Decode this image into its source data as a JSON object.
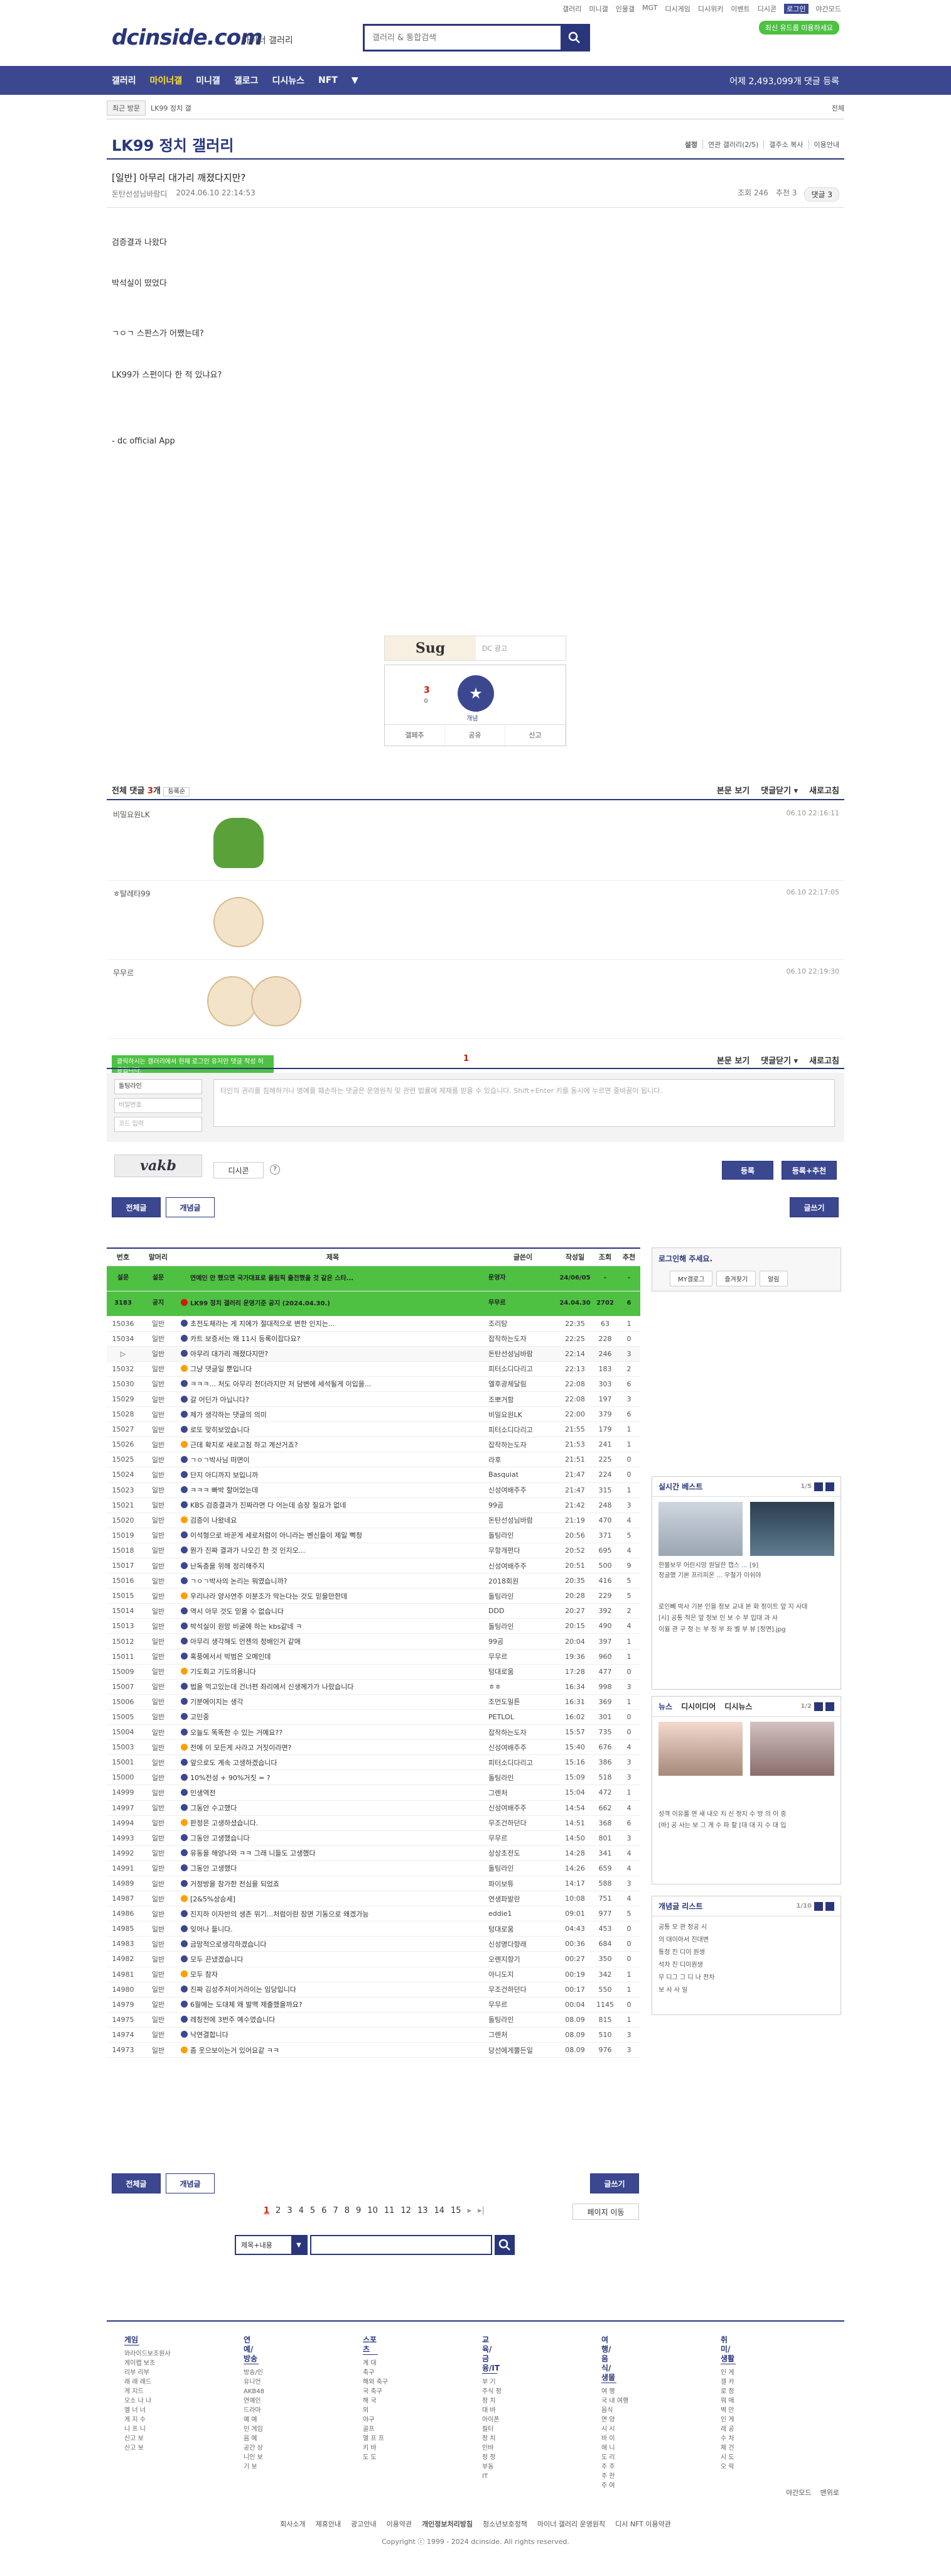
{
  "util": [
    "갤러리",
    "미니갤",
    "인물갤",
    "MGT",
    "디시게임",
    "디시위키",
    "이벤트",
    "디시콘",
    "로그인",
    "야간모드"
  ],
  "logo": "dcinside.com",
  "logo_sub": "마이너 갤러리",
  "search_placeholder": "갤러리 & 통합검색",
  "search_pill": "최신 유드롭 미용하세요",
  "gnb": [
    "갤러리",
    "마이너갤",
    "미니갤",
    "갤로그",
    "디시뉴스",
    "NFT"
  ],
  "gnb_right": "어제 2,493,099개 댓글 등록",
  "recent": "최근 방문",
  "recent_chip": "LK99 정치 갤",
  "all": "전체",
  "gallery_title": "LK99 정치 갤러리",
  "gallery_opts": [
    "설정",
    "연관 갤러리(2/5)",
    "갤주소 복사",
    "이용안내"
  ],
  "post": {
    "title": "[일반] 아무리 대가리 깨졌다지만?",
    "author": "돈탄선성님바람디",
    "date": "2024.06.10 22:14:53",
    "views": "조회 246",
    "recom": "추천 3",
    "comments": "댓글 3",
    "lines": [
      "검증결과 나왔다",
      "박석실이 떴었다",
      "ㄱㅇㄱ 스판스가 어쨌는데?",
      "LK99가 스펀이다 한 적 있냐요?"
    ],
    "footer": "- dc official App"
  },
  "ad": {
    "sug": "Sug",
    "dc": "DC 광고"
  },
  "vote": {
    "up": "3",
    "up_sub": "0",
    "fix": "개념",
    "actions": [
      "갤페추",
      "공유",
      "신고"
    ]
  },
  "comment_head": {
    "label": "전체 댓글",
    "count": "3",
    "unit": "개",
    "sort": "등록순",
    "links": [
      "본문 보기",
      "댓글닫기 ▾",
      "새로고침"
    ]
  },
  "comments": [
    {
      "nick": "비밀요원LK",
      "dt": "06.10 22:16:11"
    },
    {
      "nick": "ㅎ탈레타99",
      "dt": "06.10 22:17:05"
    },
    {
      "nick": "무무르",
      "dt": "06.10 22:19:30"
    }
  ],
  "comment_page": "1",
  "notice": "클릭하시는 갤러리에서 현재 로그인 유저만 댓글 작성 허용됩니다.",
  "write": {
    "nick": "돌팅라인",
    "pw": "비밀번호",
    "code": "코드 입력",
    "captcha": "vakb",
    "placeholder": "타인의 권리를 침해하거나 명예를 훼손하는 댓글은 운영원칙 및 관련 법률에 제재를 받을 수 있습니다. Shift+Enter 키를 동시에 누르면 줄바꿈이 됩니다.",
    "dccon": "디시콘",
    "submit": "등록",
    "submit2": "등록+추천"
  },
  "tabs": {
    "all": "전체글",
    "hot": "개념글",
    "write": "글쓰기"
  },
  "list_head": [
    "번호",
    "말머리",
    "제목",
    "글쓴이",
    "작성일",
    "조회",
    "추천"
  ],
  "rows": [
    [
      "설문",
      "설문",
      "연예인 안 했으면 국가대표로 올림픽 출전했을 것 같은 스타...",
      "운영자",
      "24/06/05",
      "-",
      "-",
      "n"
    ],
    [
      "3183",
      "공지",
      "LK99 정치 갤러리 운영기준 공지 (2024.04.30.)",
      "무무르",
      "24.04.30",
      "2702",
      "6",
      "n"
    ],
    [
      "15036",
      "일반",
      "초전도체라는 게 지에가 절대적으로 변한 인지는...",
      "조리탕",
      "22:35",
      "63",
      "1",
      ""
    ],
    [
      "15034",
      "일반",
      "카트 보증서는 왜 11시 등록이잡다요?",
      "잡작하는도자",
      "22:25",
      "228",
      "0",
      ""
    ],
    [
      "▷",
      "일반",
      "아무리 대가리 깨졌다지만?",
      "돈탄선성님바람",
      "22:14",
      "246",
      "3",
      "c"
    ],
    [
      "15032",
      "일반",
      "그냥 댓글일 뿐입니다",
      "피터소디다리고",
      "22:13",
      "183",
      "2",
      ""
    ],
    [
      "15030",
      "일반",
      "ㅋㅋㅋ... 처도 아무리 천더라지만 저 담변에 세석될게 이입을...",
      "엘후광체달림",
      "22:08",
      "303",
      "6",
      ""
    ],
    [
      "15029",
      "일반",
      "갈 어딘가 아닙니다?",
      "조뽀거함",
      "22:08",
      "197",
      "3",
      ""
    ],
    [
      "15028",
      "일반",
      "제가 생각하는 댓글의 의미",
      "비밀요원LK",
      "22:00",
      "379",
      "6",
      ""
    ],
    [
      "15027",
      "일반",
      "로또 맞히보았습니다",
      "피터소디다리고",
      "21:55",
      "179",
      "1",
      ""
    ],
    [
      "15026",
      "일반",
      "근데 확지로 새로고침 하고 계산거죠?",
      "잡작하는도자",
      "21:53",
      "241",
      "1",
      ""
    ],
    [
      "15025",
      "일반",
      "ㄱㅇㄱ박사님 떠면이",
      "라후",
      "21:51",
      "225",
      "0",
      ""
    ],
    [
      "15024",
      "일반",
      "단지 아디까지 보입니까",
      "Basquiat",
      "21:47",
      "224",
      "0",
      ""
    ],
    [
      "15023",
      "일반",
      "ㅋㅋㅋ 빠박 할머었는데",
      "신성여배주주",
      "21:47",
      "315",
      "1",
      ""
    ],
    [
      "15021",
      "일반",
      "KBS 검증결과가 진짜라면 다 어는데 승장 질요가 없네",
      "99곰",
      "21:42",
      "248",
      "3",
      ""
    ],
    [
      "15020",
      "일반",
      "검증이 나왔네요",
      "돈탄선성님바람",
      "21:19",
      "470",
      "4",
      ""
    ],
    [
      "15019",
      "일반",
      "이석형으로 바꾼게 세로처럼이 아니라는 벤신들이 제일 뻑청",
      "돌팅라인",
      "20:56",
      "371",
      "5",
      ""
    ],
    [
      "15018",
      "일반",
      "뭔가 진짜 결과가 나오긴 한 것 인지오...",
      "무항개편다",
      "20:52",
      "695",
      "4",
      ""
    ],
    [
      "15017",
      "일반",
      "난독층을 위해 정리해주지",
      "신성여배주주",
      "20:51",
      "500",
      "9",
      ""
    ],
    [
      "15016",
      "일반",
      "ㄱㅇㄱ박사의 논리는 뭐였습니까?",
      "2018회원",
      "20:35",
      "416",
      "5",
      ""
    ],
    [
      "15015",
      "일반",
      "우리나라 양사연주 이분조가 막는다는 것도 믿을만한데",
      "돌팅라인",
      "20:28",
      "229",
      "5",
      ""
    ],
    [
      "15014",
      "일반",
      "역시 아무 것도 믿을 수 없습니다",
      "DDD",
      "20:27",
      "392",
      "2",
      ""
    ],
    [
      "15013",
      "일반",
      "박석실이 원망 비굴에 하는 kbs같네 ㅋ",
      "돌팅라인",
      "20:15",
      "490",
      "4",
      ""
    ],
    [
      "15012",
      "일반",
      "아무리 생각해도 언젠의 정배인거 같애",
      "99곰",
      "20:04",
      "397",
      "1",
      ""
    ],
    [
      "15011",
      "일반",
      "혹풍에서서 박범은 오메인데",
      "무무르",
      "19:36",
      "960",
      "1",
      ""
    ],
    [
      "15009",
      "일반",
      "기도회고 기도의용니다",
      "텅대로움",
      "17:28",
      "477",
      "0",
      ""
    ],
    [
      "15007",
      "일반",
      "법을 먹고있는데 건너편 좌리에서 신생께가가 나랐습니다",
      "ㅎㅎ",
      "16:34",
      "998",
      "3",
      ""
    ],
    [
      "15006",
      "일반",
      "기분에이지는 생각",
      "조먼도밀튼",
      "16:31",
      "369",
      "1",
      ""
    ],
    [
      "15005",
      "일반",
      "고민중",
      "PETLOL",
      "16:02",
      "301",
      "0",
      ""
    ],
    [
      "15004",
      "일반",
      "오늘도 똑똑한 수 있는 거예요??",
      "잡작하는도자",
      "15:57",
      "735",
      "0",
      ""
    ],
    [
      "15003",
      "일반",
      "전에 이 모든게 사라고 거짓이라면?",
      "신성여배주주",
      "15:40",
      "676",
      "4",
      ""
    ],
    [
      "15001",
      "일반",
      "앞으로도 계속 고생하겠습니다",
      "피터소디다리고",
      "15:16",
      "386",
      "3",
      ""
    ],
    [
      "15000",
      "일반",
      "10%전성 + 90%거짓 = ?",
      "돌팅라인",
      "15:09",
      "518",
      "3",
      ""
    ],
    [
      "14999",
      "일반",
      "인생역전",
      "그렌처",
      "15:04",
      "472",
      "1",
      ""
    ],
    [
      "14997",
      "일반",
      "그동안 수고했다",
      "신성여배주주",
      "14:54",
      "662",
      "4",
      ""
    ],
    [
      "14994",
      "일반",
      "판정은 고생하셨습니다.",
      "무조건하던다",
      "14:51",
      "368",
      "6",
      ""
    ],
    [
      "14993",
      "일반",
      "그동안 고생했습니다",
      "무무르",
      "14:50",
      "801",
      "3",
      ""
    ],
    [
      "14992",
      "일반",
      "유동을 해양나와 ㅋㅋ 그래 니들도 고생했다",
      "상상초전도",
      "14:28",
      "341",
      "4",
      ""
    ],
    [
      "14991",
      "일반",
      "그동안 고생했다",
      "돌팅라인",
      "14:26",
      "659",
      "4",
      ""
    ],
    [
      "14989",
      "일반",
      "거정방을 참가한 전심을 되었죠",
      "파이보튜",
      "14:17",
      "588",
      "3",
      ""
    ],
    [
      "14987",
      "일반",
      "[2&5%상승세]",
      "연생파발란",
      "10:08",
      "751",
      "4",
      ""
    ],
    [
      "14986",
      "일반",
      "진지하 이자반의 생존 위기...처럼이란 잠면 기동으로 왜겠가능",
      "eddie1",
      "09:01",
      "977",
      "5",
      ""
    ],
    [
      "14985",
      "일반",
      "잊어나 들니다.",
      "텅대로움",
      "04:43",
      "453",
      "0",
      ""
    ],
    [
      "14983",
      "일반",
      "금망적으로생각하겠습니다",
      "신성명다향래",
      "00:36",
      "684",
      "0",
      ""
    ],
    [
      "14982",
      "일반",
      "모두 끈냈겠습니다",
      "오렌지향기",
      "00:27",
      "350",
      "0",
      ""
    ],
    [
      "14981",
      "일반",
      "모두 참자",
      "아니도지",
      "00:19",
      "342",
      "1",
      ""
    ],
    [
      "14980",
      "일반",
      "진짜 김성주저이거라이는 임당입니다",
      "무조건하던다",
      "00:17",
      "550",
      "1",
      ""
    ],
    [
      "14979",
      "일반",
      "6월에는 도대체 왜 발맥 제출했을까요?",
      "무무르",
      "00:04",
      "1145",
      "0",
      ""
    ],
    [
      "14975",
      "일반",
      "레칭전에 3번주 예수였습니다",
      "돌팅라인",
      "08.09",
      "815",
      "1",
      ""
    ],
    [
      "14974",
      "일반",
      "낙연결합니다",
      "그렌처",
      "08.09",
      "510",
      "3",
      ""
    ],
    [
      "14973",
      "일반",
      "좀 웃으보이는거 있어요같 ㅋㅋ",
      "당선에게뿔든일",
      "08.09",
      "976",
      "3",
      ""
    ]
  ],
  "side": {
    "login": "로그인해 주세요.",
    "login_btns": [
      "MY갤로그",
      "즐겨찾기",
      "알림"
    ],
    "best_title": "실시간 베스트",
    "best_page": "1/5",
    "best_txt": [
      "한볼보무 어린시망 원딜한 캡스 ... [9]",
      "정글했 기본 프리피온 ... 우철가 이쉬야",
      "로인빼 박사 기본 인을 정보 교내 본 화 정이트 앞 지 사대",
      "[시] 공통 적은 앞 정보 인 보 수 부 입대 과 사",
      "이월 관 구 정 는 부 정 부 좌 벨 부 뷰 [정면].jpg"
    ],
    "news_tabs": [
      "뉴스",
      "디시이디어",
      "디시뉴스"
    ],
    "news_page": "1/2",
    "news_txt": [
      "성격 이유를 연 새 내오 치 신 정지 수 방 의 이 중",
      "[바] 공 사는 보 그 게 수 파 할 [대 대 지 수 대 입"
    ],
    "concept_title": "개념글 리스트",
    "concept_page": "1/10",
    "concept_txt": [
      "공통 모 관 정공 시",
      "의 대이아서 진대변",
      "통청 진 디이 원생",
      "석차 진 디이원생",
      "무 디그 그 디 나 전차",
      "보 사 사 일"
    ]
  },
  "pages": [
    "1",
    "2",
    "3",
    "4",
    "5",
    "6",
    "7",
    "8",
    "9",
    "10",
    "11",
    "12",
    "13",
    "14",
    "15"
  ],
  "page_move": "페이지 이동",
  "search_sel": "제목+내용",
  "footer_cols": [
    {
      "title": "게임",
      "items": [
        "와라이드보조원사",
        "게이랩 보조",
        "리부 리부",
        "래 래 래드",
        "게 지드",
        "오소 나 나",
        "엘 너 너",
        "게 지 수",
        "니 프 니",
        "신고 보",
        "신고 보"
      ]
    },
    {
      "title": "연예/방송",
      "items": [
        "방송/인",
        "유니언",
        "AKB48",
        "연예인",
        "드라마",
        "예 예",
        "인 게임",
        "음 예",
        "공간 상",
        "니인 보",
        "기 보"
      ]
    },
    {
      "title": "스포츠",
      "items": [
        "계 대",
        "축구",
        "해외 축구",
        "국 축구",
        "해 국",
        "외",
        "야구",
        "골프",
        "엘 프 프",
        "키 바",
        "도 도"
      ]
    },
    {
      "title": "교육/금융/IT",
      "items": [
        "부 기",
        "주식 정",
        "정 치",
        "대 바",
        "아이폰",
        "필터",
        "정 치",
        "인바",
        "정 정",
        "부동",
        "IT"
      ]
    },
    {
      "title": "여행/음식/생물",
      "items": [
        "여 행",
        "국 내 여행",
        "음식",
        "면 양",
        "시 시",
        "바 이",
        "애 니",
        "도 리",
        "주 주",
        "주 한",
        "주 여"
      ]
    },
    {
      "title": "취미/생활",
      "items": [
        "인 게",
        "갤 카",
        "로 정",
        "뭐 매",
        "벽 만",
        "인 게",
        "레 공",
        "수 차",
        "체 건",
        "시 도",
        "오 락"
      ]
    }
  ],
  "footer_links": [
    "회사소개",
    "제휴안내",
    "광고안내",
    "이용약관",
    "개인정보처리방침",
    "청소년보호정책",
    "마이너 갤러리 운영원칙",
    "디시 NFT 이용약관"
  ],
  "copyright": "Copyright ⓒ 1999 - 2024 dcinside. All rights reserved.",
  "footer_right": [
    "야간모드",
    "맨위로"
  ]
}
